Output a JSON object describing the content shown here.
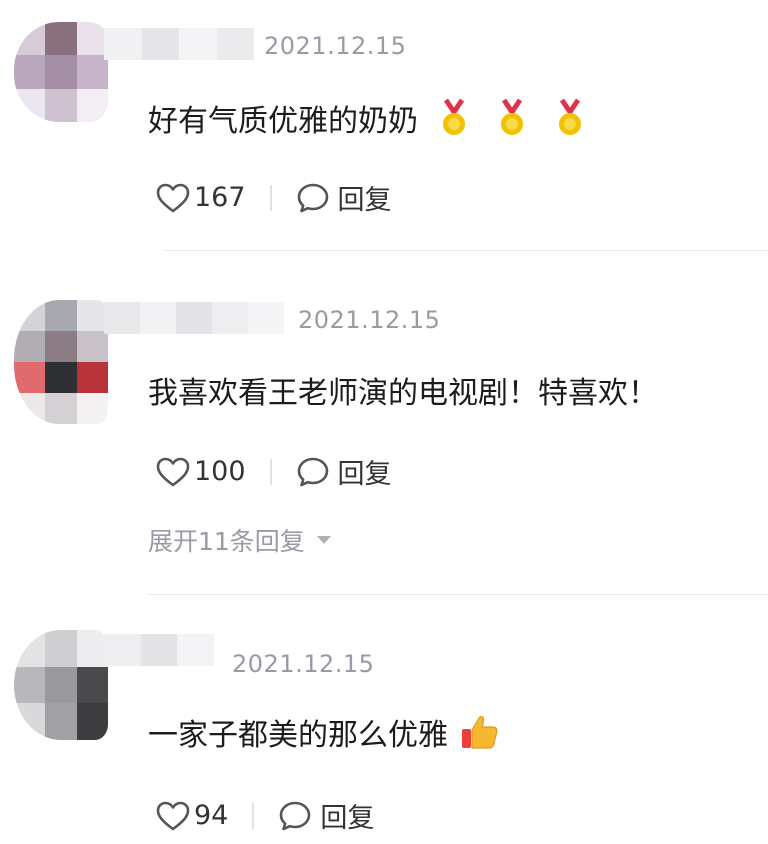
{
  "comments": [
    {
      "date": "2021.12.15",
      "text": "好有气质优雅的奶奶",
      "emojis": [
        "medal-icon",
        "medal-icon",
        "medal-icon"
      ],
      "likes": "167",
      "reply_label": "回复"
    },
    {
      "date": "2021.12.15",
      "text": "我喜欢看王老师演的电视剧！特喜欢！",
      "likes": "100",
      "reply_label": "回复",
      "expand_label": "展开11条回复"
    },
    {
      "date": "2021.12.15",
      "text": "一家子都美的那么优雅",
      "emojis": [
        "thumbs-up-icon"
      ],
      "likes": "94",
      "reply_label": "回复"
    }
  ],
  "colors": {
    "meta_gray": "#9a9aa5",
    "text": "#1c1c1c",
    "divider": "#ececef"
  }
}
